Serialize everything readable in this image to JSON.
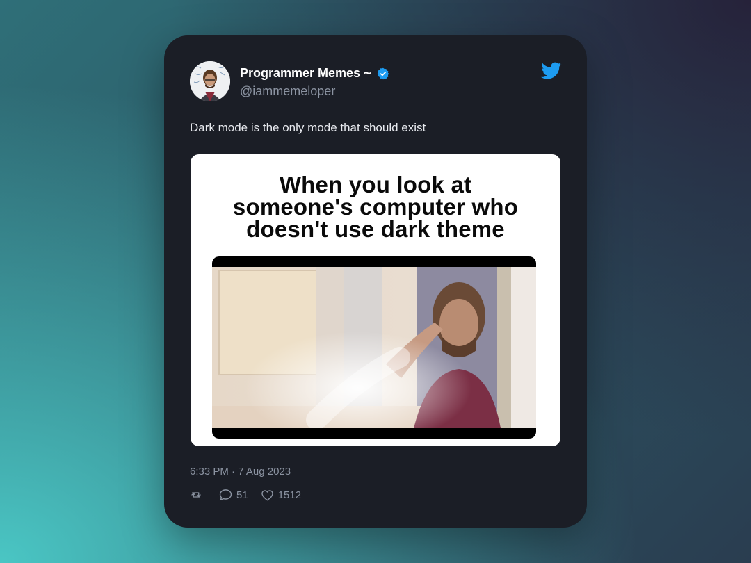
{
  "tweet": {
    "author": {
      "name": "Programmer Memes ~",
      "handle": "@iammemeloper",
      "verified": true
    },
    "text": "Dark mode is the only mode that should exist",
    "media": {
      "caption_lines": [
        "When you look at",
        "someone's computer who",
        "doesn't use dark theme"
      ]
    },
    "timestamp": "6:33 PM · 7 Aug 2023",
    "stats": {
      "retweets": "",
      "replies": "51",
      "likes": "1512"
    }
  },
  "icons": {
    "logo": "twitter-bird-icon",
    "verified": "verified-badge-icon",
    "retweet": "retweet-icon",
    "reply": "reply-icon",
    "like": "heart-icon"
  },
  "colors": {
    "card_background": "#1b1e26",
    "twitter_blue": "#1d9bf0",
    "name_text": "#ffffff",
    "secondary_text": "#8b93a1"
  }
}
